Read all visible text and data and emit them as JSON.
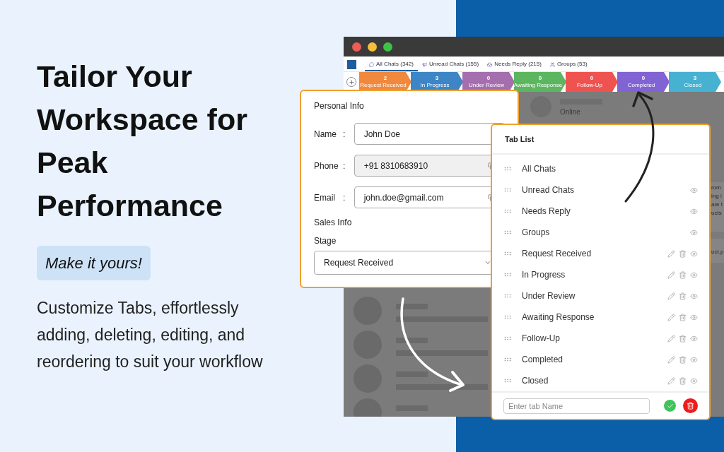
{
  "hero": {
    "title": "Tailor Your Workspace for Peak Performance",
    "badge": "Make it yours!",
    "description": "Customize Tabs, effortlessly adding, deleting, editing, and reordering to suit your workflow"
  },
  "window": {
    "tabs": [
      {
        "label": "All Chats (342)",
        "selected": true
      },
      {
        "label": "Unread Chats (155)",
        "selected": false
      },
      {
        "label": "Needs Reply (215)",
        "selected": false
      },
      {
        "label": "Groups (53)",
        "selected": false
      }
    ],
    "stages": [
      {
        "count": "2",
        "label": "Request Received",
        "color": "#f0883e"
      },
      {
        "count": "3",
        "label": "In Progress",
        "color": "#3d85c6"
      },
      {
        "count": "0",
        "label": "Under Review",
        "color": "#a56eaf"
      },
      {
        "count": "0",
        "label": "Awaiting Response",
        "color": "#5cb660"
      },
      {
        "count": "0",
        "label": "Follow-Up",
        "color": "#ef5350"
      },
      {
        "count": "0",
        "label": "Completed",
        "color": "#8163d3"
      },
      {
        "count": "3",
        "label": "Closed",
        "color": "#46b1d0"
      }
    ],
    "chat_status": "Online",
    "message_fragments": [
      "rom",
      "ing i",
      "are t",
      "ucts"
    ],
    "attachment_fragment": "uct.p"
  },
  "personal_info": {
    "title": "Personal Info",
    "fields": [
      {
        "label": "Name",
        "colon": ":",
        "value": "John Doe",
        "disabled": false,
        "copyable": false
      },
      {
        "label": "Phone",
        "colon": ":",
        "value": "+91 8310683910",
        "disabled": true,
        "copyable": true
      },
      {
        "label": "Email",
        "colon": ":",
        "value": "john.doe@gmail.com",
        "disabled": false,
        "copyable": true
      }
    ],
    "sales_title": "Sales Info",
    "stage_label": "Stage",
    "stage_value": "Request Received"
  },
  "tab_list": {
    "title": "Tab List",
    "items": [
      {
        "label": "All Chats",
        "kind": "base"
      },
      {
        "label": "Unread Chats",
        "kind": "system"
      },
      {
        "label": "Needs Reply",
        "kind": "system"
      },
      {
        "label": "Groups",
        "kind": "system"
      },
      {
        "label": "Request Received",
        "kind": "custom"
      },
      {
        "label": "In Progress",
        "kind": "custom"
      },
      {
        "label": "Under Review",
        "kind": "custom"
      },
      {
        "label": "Awaiting Response",
        "kind": "custom"
      },
      {
        "label": "Follow-Up",
        "kind": "custom"
      },
      {
        "label": "Completed",
        "kind": "custom"
      },
      {
        "label": "Closed",
        "kind": "custom"
      }
    ],
    "placeholder": "Enter tab Name"
  }
}
